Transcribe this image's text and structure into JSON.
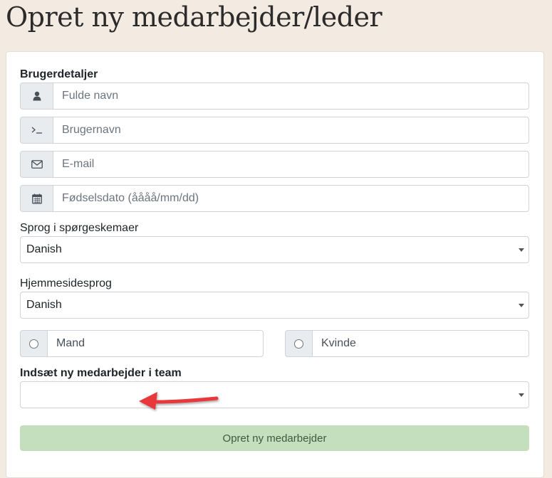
{
  "page": {
    "title": "Opret ny medarbejder/leder"
  },
  "form": {
    "section_title": "Brugerdetaljer",
    "fields": [
      {
        "icon": "user-icon",
        "placeholder": "Fulde navn"
      },
      {
        "icon": "terminal-icon",
        "placeholder": "Brugernavn"
      },
      {
        "icon": "envelope-icon",
        "placeholder": "E-mail"
      },
      {
        "icon": "calendar-icon",
        "placeholder": "Fødselsdato (åååå/mm/dd)"
      }
    ],
    "questionnaire_language": {
      "label": "Sprog i spørgeskemaer",
      "value": "Danish"
    },
    "website_language": {
      "label": "Hjemmesidesprog",
      "value": "Danish"
    },
    "gender": {
      "male": {
        "label": "Mand",
        "checked": false
      },
      "female": {
        "label": "Kvinde",
        "checked": false
      }
    },
    "team": {
      "label": "Indsæt ny medarbejder i team",
      "value": ""
    },
    "submit_label": "Opret ny medarbejder"
  },
  "annotation": {
    "arrow_color": "#e8383b"
  }
}
